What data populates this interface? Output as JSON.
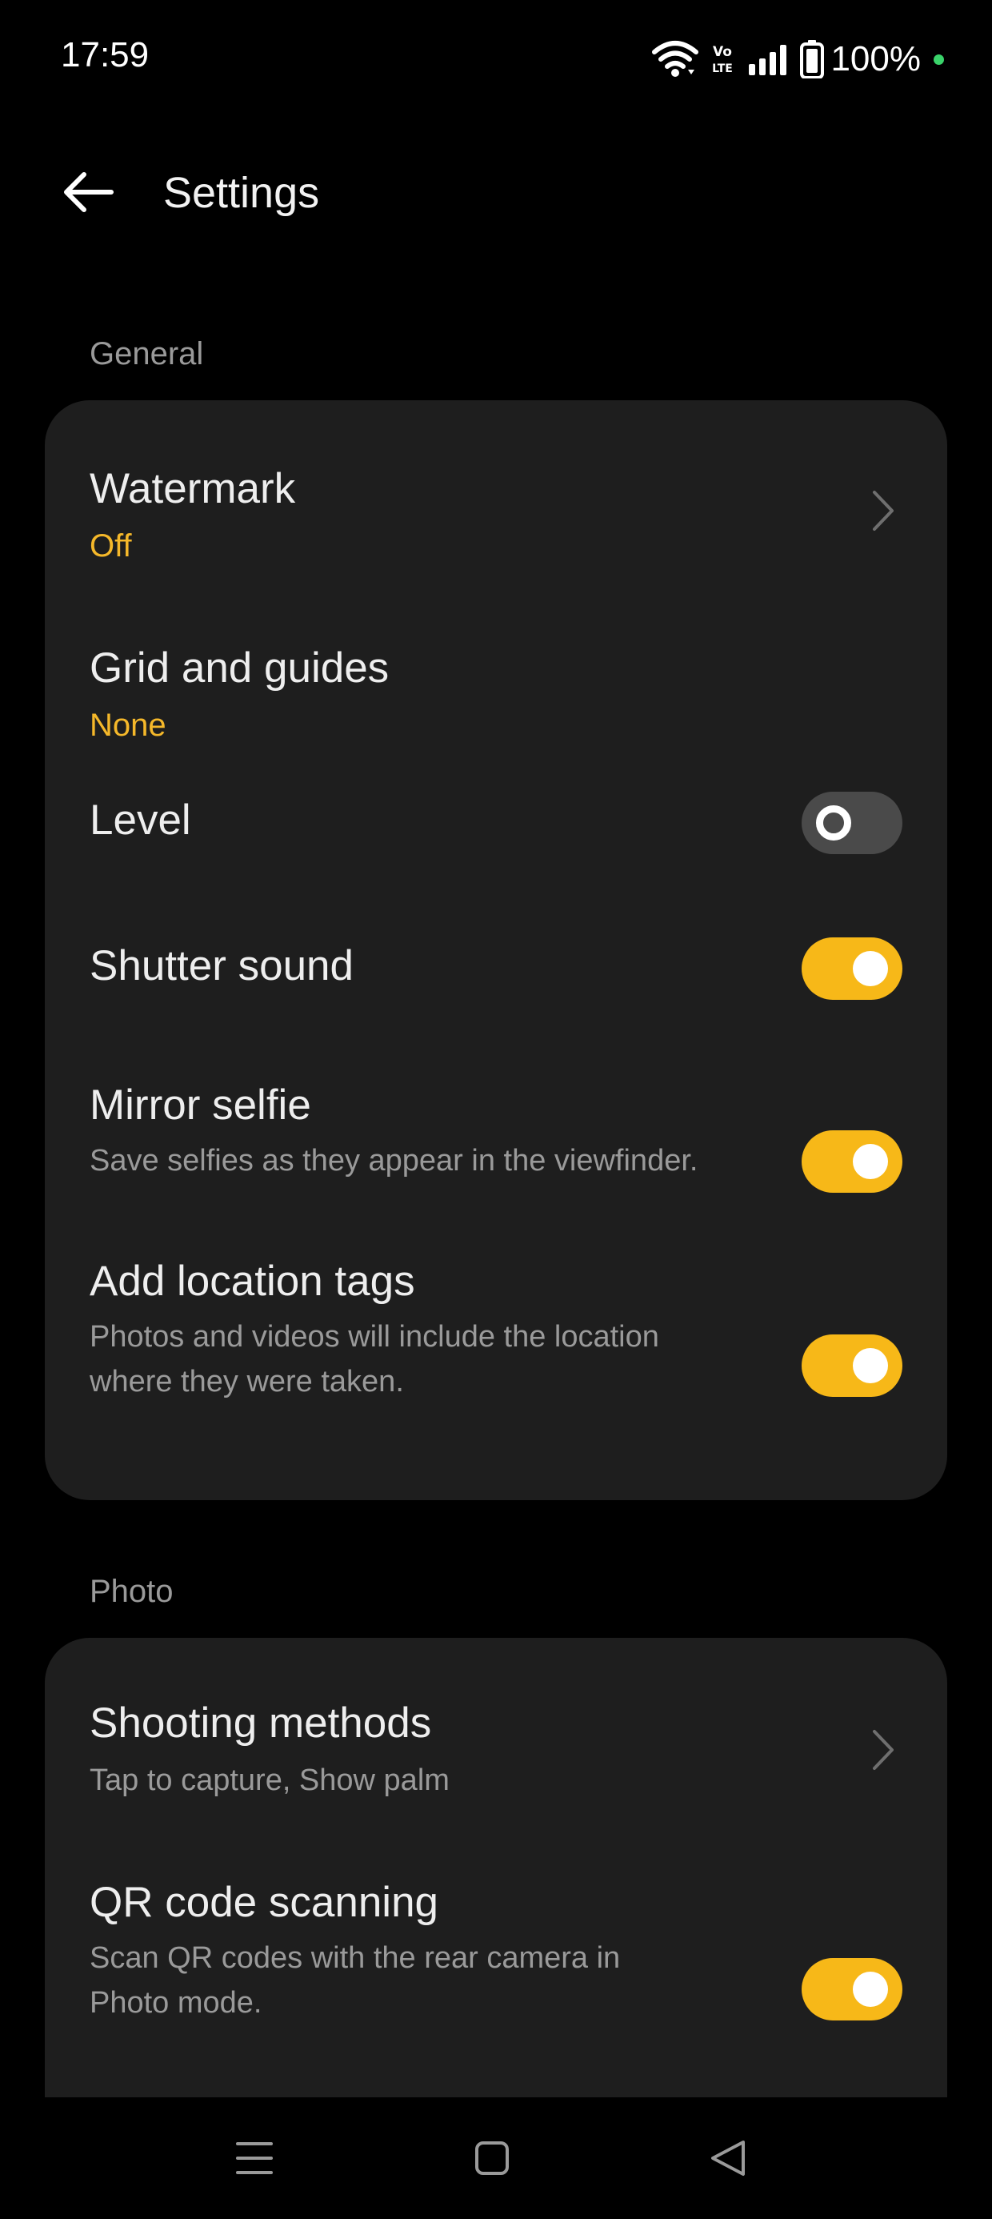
{
  "status_bar": {
    "time": "17:59",
    "battery": "100%",
    "network": "Vo LTE",
    "icons": [
      "wifi-icon",
      "volte-icon",
      "signal-icon",
      "battery-icon"
    ],
    "dot_color": "#3ad36a"
  },
  "header": {
    "title": "Settings",
    "back_icon": "arrow-left-icon"
  },
  "general": {
    "label": "General",
    "items": [
      {
        "title": "Watermark",
        "value": "Off",
        "control": "chevron"
      },
      {
        "title": "Grid and guides",
        "value": "None",
        "control": "none"
      },
      {
        "title": "Level",
        "control": "toggle",
        "checked": false
      },
      {
        "title": "Shutter sound",
        "control": "toggle",
        "checked": true
      },
      {
        "title": "Mirror selfie",
        "desc": "Save selfies as they appear in the viewfinder.",
        "control": "toggle",
        "checked": true
      },
      {
        "title": "Add location tags",
        "desc_line1": "Photos and videos will include the location",
        "desc_line2": "where they were taken.",
        "control": "toggle",
        "checked": true
      }
    ]
  },
  "photo": {
    "label": "Photo",
    "items": [
      {
        "title": "Shooting methods",
        "desc": "Tap to capture, Show palm",
        "control": "chevron"
      },
      {
        "title": "QR code scanning",
        "desc_line1": "Scan QR codes with the rear camera in",
        "desc_line2": "Photo mode.",
        "control": "toggle",
        "checked": true
      }
    ]
  },
  "nav_bar": {
    "icons": [
      "menu-icon",
      "home-icon",
      "back-triangle-icon"
    ]
  },
  "colors": {
    "accent": "#f7b818",
    "value_text": "#f5b82a",
    "card_bg": "#1e1e1e",
    "background": "#000000"
  }
}
